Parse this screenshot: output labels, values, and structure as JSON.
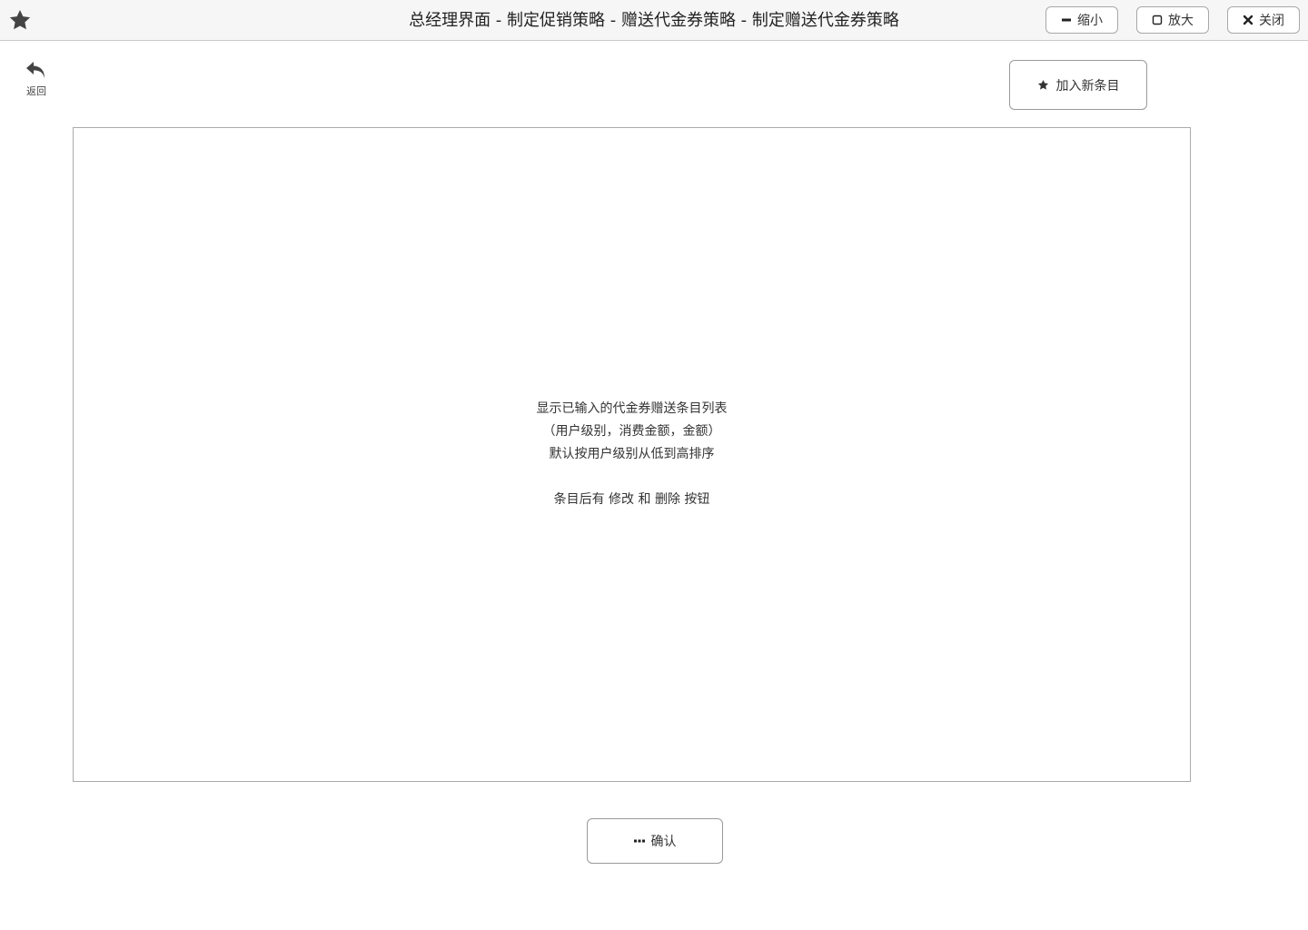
{
  "window": {
    "title": "总经理界面 - 制定促销策略 - 赠送代金券策略 - 制定赠送代金券策略",
    "app_icon": "star-icon",
    "controls": {
      "minimize_label": "缩小",
      "minimize_icon": "minus-icon",
      "maximize_label": "放大",
      "maximize_icon": "square-icon",
      "close_label": "关闭",
      "close_icon": "x-icon"
    }
  },
  "toolbar": {
    "back_label": "返回",
    "back_icon": "undo-arrow-icon",
    "add_item_label": "加入新条目",
    "add_item_icon": "star-icon"
  },
  "list": {
    "placeholder_lines": [
      "显示已输入的代金券赠送条目列表",
      "（用户级别，消费金额，金额）",
      "默认按用户级别从低到高排序",
      "条目后有 修改 和 删除 按钮"
    ]
  },
  "footer": {
    "confirm_label": "确认",
    "confirm_icon": "ellipsis-icon"
  },
  "colors": {
    "titlebar_bg": "#f6f6f6",
    "border": "#aaaaaa",
    "text": "#333333",
    "icon": "#444444"
  }
}
